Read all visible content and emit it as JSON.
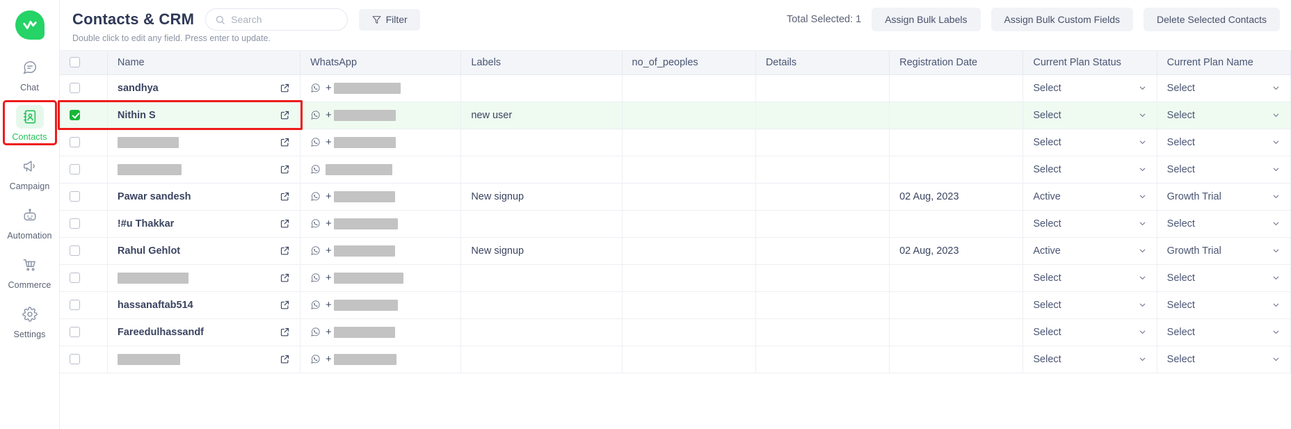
{
  "sidebar": {
    "logo_name": "wati-logo",
    "items": [
      {
        "label": "Chat",
        "icon": "chat-icon",
        "active": false,
        "highlighted": false
      },
      {
        "label": "Contacts",
        "icon": "contacts-book-icon",
        "active": true,
        "highlighted": true
      },
      {
        "label": "Campaign",
        "icon": "megaphone-icon",
        "active": false,
        "highlighted": false
      },
      {
        "label": "Automation",
        "icon": "robot-icon",
        "active": false,
        "highlighted": false
      },
      {
        "label": "Commerce",
        "icon": "shopping-cart-icon",
        "active": false,
        "highlighted": false
      },
      {
        "label": "Settings",
        "icon": "gear-icon",
        "active": false,
        "highlighted": false
      }
    ]
  },
  "header": {
    "title": "Contacts & CRM",
    "search": {
      "value": "",
      "placeholder": "Search",
      "icon": "search-icon"
    },
    "filter_label": "Filter",
    "filter_icon": "funnel-icon",
    "total_selected": "Total Selected: 1",
    "buttons": [
      "Assign Bulk Labels",
      "Assign Bulk Custom Fields",
      "Delete Selected Contacts"
    ],
    "hint": "Double click to edit any field. Press enter to update."
  },
  "table": {
    "columns": [
      "Name",
      "WhatsApp",
      "Labels",
      "no_of_peoples",
      "Details",
      "Registration Date",
      "Current Plan Status",
      "Current Plan Name"
    ],
    "select_placeholder": "Select",
    "rows": [
      {
        "checked": false,
        "name": "sandhya",
        "name_redacted": false,
        "redact_w": 0,
        "wa_plus": true,
        "wa_redact_w": 96,
        "labels": "",
        "no_of_peoples": "",
        "details": "",
        "registration_date": "",
        "plan_status": "Select",
        "plan_name": "Select",
        "selected": false,
        "highlighted": false
      },
      {
        "checked": true,
        "name": "Nithin S",
        "name_redacted": false,
        "redact_w": 0,
        "wa_plus": true,
        "wa_redact_w": 89,
        "labels": "new user",
        "no_of_peoples": "",
        "details": "",
        "registration_date": "",
        "plan_status": "Select",
        "plan_name": "Select",
        "selected": true,
        "highlighted": true
      },
      {
        "checked": false,
        "name": "",
        "name_redacted": true,
        "redact_w": 88,
        "wa_plus": true,
        "wa_redact_w": 89,
        "labels": "",
        "no_of_peoples": "",
        "details": "",
        "registration_date": "",
        "plan_status": "Select",
        "plan_name": "Select",
        "selected": false,
        "highlighted": false
      },
      {
        "checked": false,
        "name": "",
        "name_redacted": true,
        "redact_w": 92,
        "wa_plus": false,
        "wa_redact_w": 96,
        "labels": "",
        "no_of_peoples": "",
        "details": "",
        "registration_date": "",
        "plan_status": "Select",
        "plan_name": "Select",
        "selected": false,
        "highlighted": false
      },
      {
        "checked": false,
        "name": "Pawar sandesh",
        "name_redacted": false,
        "redact_w": 0,
        "wa_plus": true,
        "wa_redact_w": 88,
        "labels": "New signup",
        "no_of_peoples": "",
        "details": "",
        "registration_date": "02 Aug, 2023",
        "plan_status": "Active",
        "plan_name": "Growth Trial",
        "selected": false,
        "highlighted": false
      },
      {
        "checked": false,
        "name": "!#u Thakkar",
        "name_redacted": false,
        "redact_w": 0,
        "wa_plus": true,
        "wa_redact_w": 92,
        "labels": "",
        "no_of_peoples": "",
        "details": "",
        "registration_date": "",
        "plan_status": "Select",
        "plan_name": "Select",
        "selected": false,
        "highlighted": false
      },
      {
        "checked": false,
        "name": "Rahul Gehlot",
        "name_redacted": false,
        "redact_w": 0,
        "wa_plus": true,
        "wa_redact_w": 88,
        "labels": "New signup",
        "no_of_peoples": "",
        "details": "",
        "registration_date": "02 Aug, 2023",
        "plan_status": "Active",
        "plan_name": "Growth Trial",
        "selected": false,
        "highlighted": false
      },
      {
        "checked": false,
        "name": "",
        "name_redacted": true,
        "redact_w": 102,
        "wa_plus": true,
        "wa_redact_w": 100,
        "labels": "",
        "no_of_peoples": "",
        "details": "",
        "registration_date": "",
        "plan_status": "Select",
        "plan_name": "Select",
        "selected": false,
        "highlighted": false
      },
      {
        "checked": false,
        "name": "hassanaftab514",
        "name_redacted": false,
        "redact_w": 0,
        "wa_plus": true,
        "wa_redact_w": 92,
        "labels": "",
        "no_of_peoples": "",
        "details": "",
        "registration_date": "",
        "plan_status": "Select",
        "plan_name": "Select",
        "selected": false,
        "highlighted": false
      },
      {
        "checked": false,
        "name": "Fareedulhassandf",
        "name_redacted": false,
        "redact_w": 0,
        "wa_plus": true,
        "wa_redact_w": 88,
        "labels": "",
        "no_of_peoples": "",
        "details": "",
        "registration_date": "",
        "plan_status": "Select",
        "plan_name": "Select",
        "selected": false,
        "highlighted": false
      },
      {
        "checked": false,
        "name": "",
        "name_redacted": true,
        "redact_w": 90,
        "wa_plus": true,
        "wa_redact_w": 90,
        "labels": "",
        "no_of_peoples": "",
        "details": "",
        "registration_date": "",
        "plan_status": "Select",
        "plan_name": "Select",
        "selected": false,
        "highlighted": false
      }
    ]
  },
  "colors": {
    "brand_green": "#25d366",
    "accent_green": "#23c158",
    "selected_row": "#effbf1",
    "highlight_red": "#ee1b1b",
    "header_bg": "#f3f5f9",
    "text": "#3b4561"
  }
}
